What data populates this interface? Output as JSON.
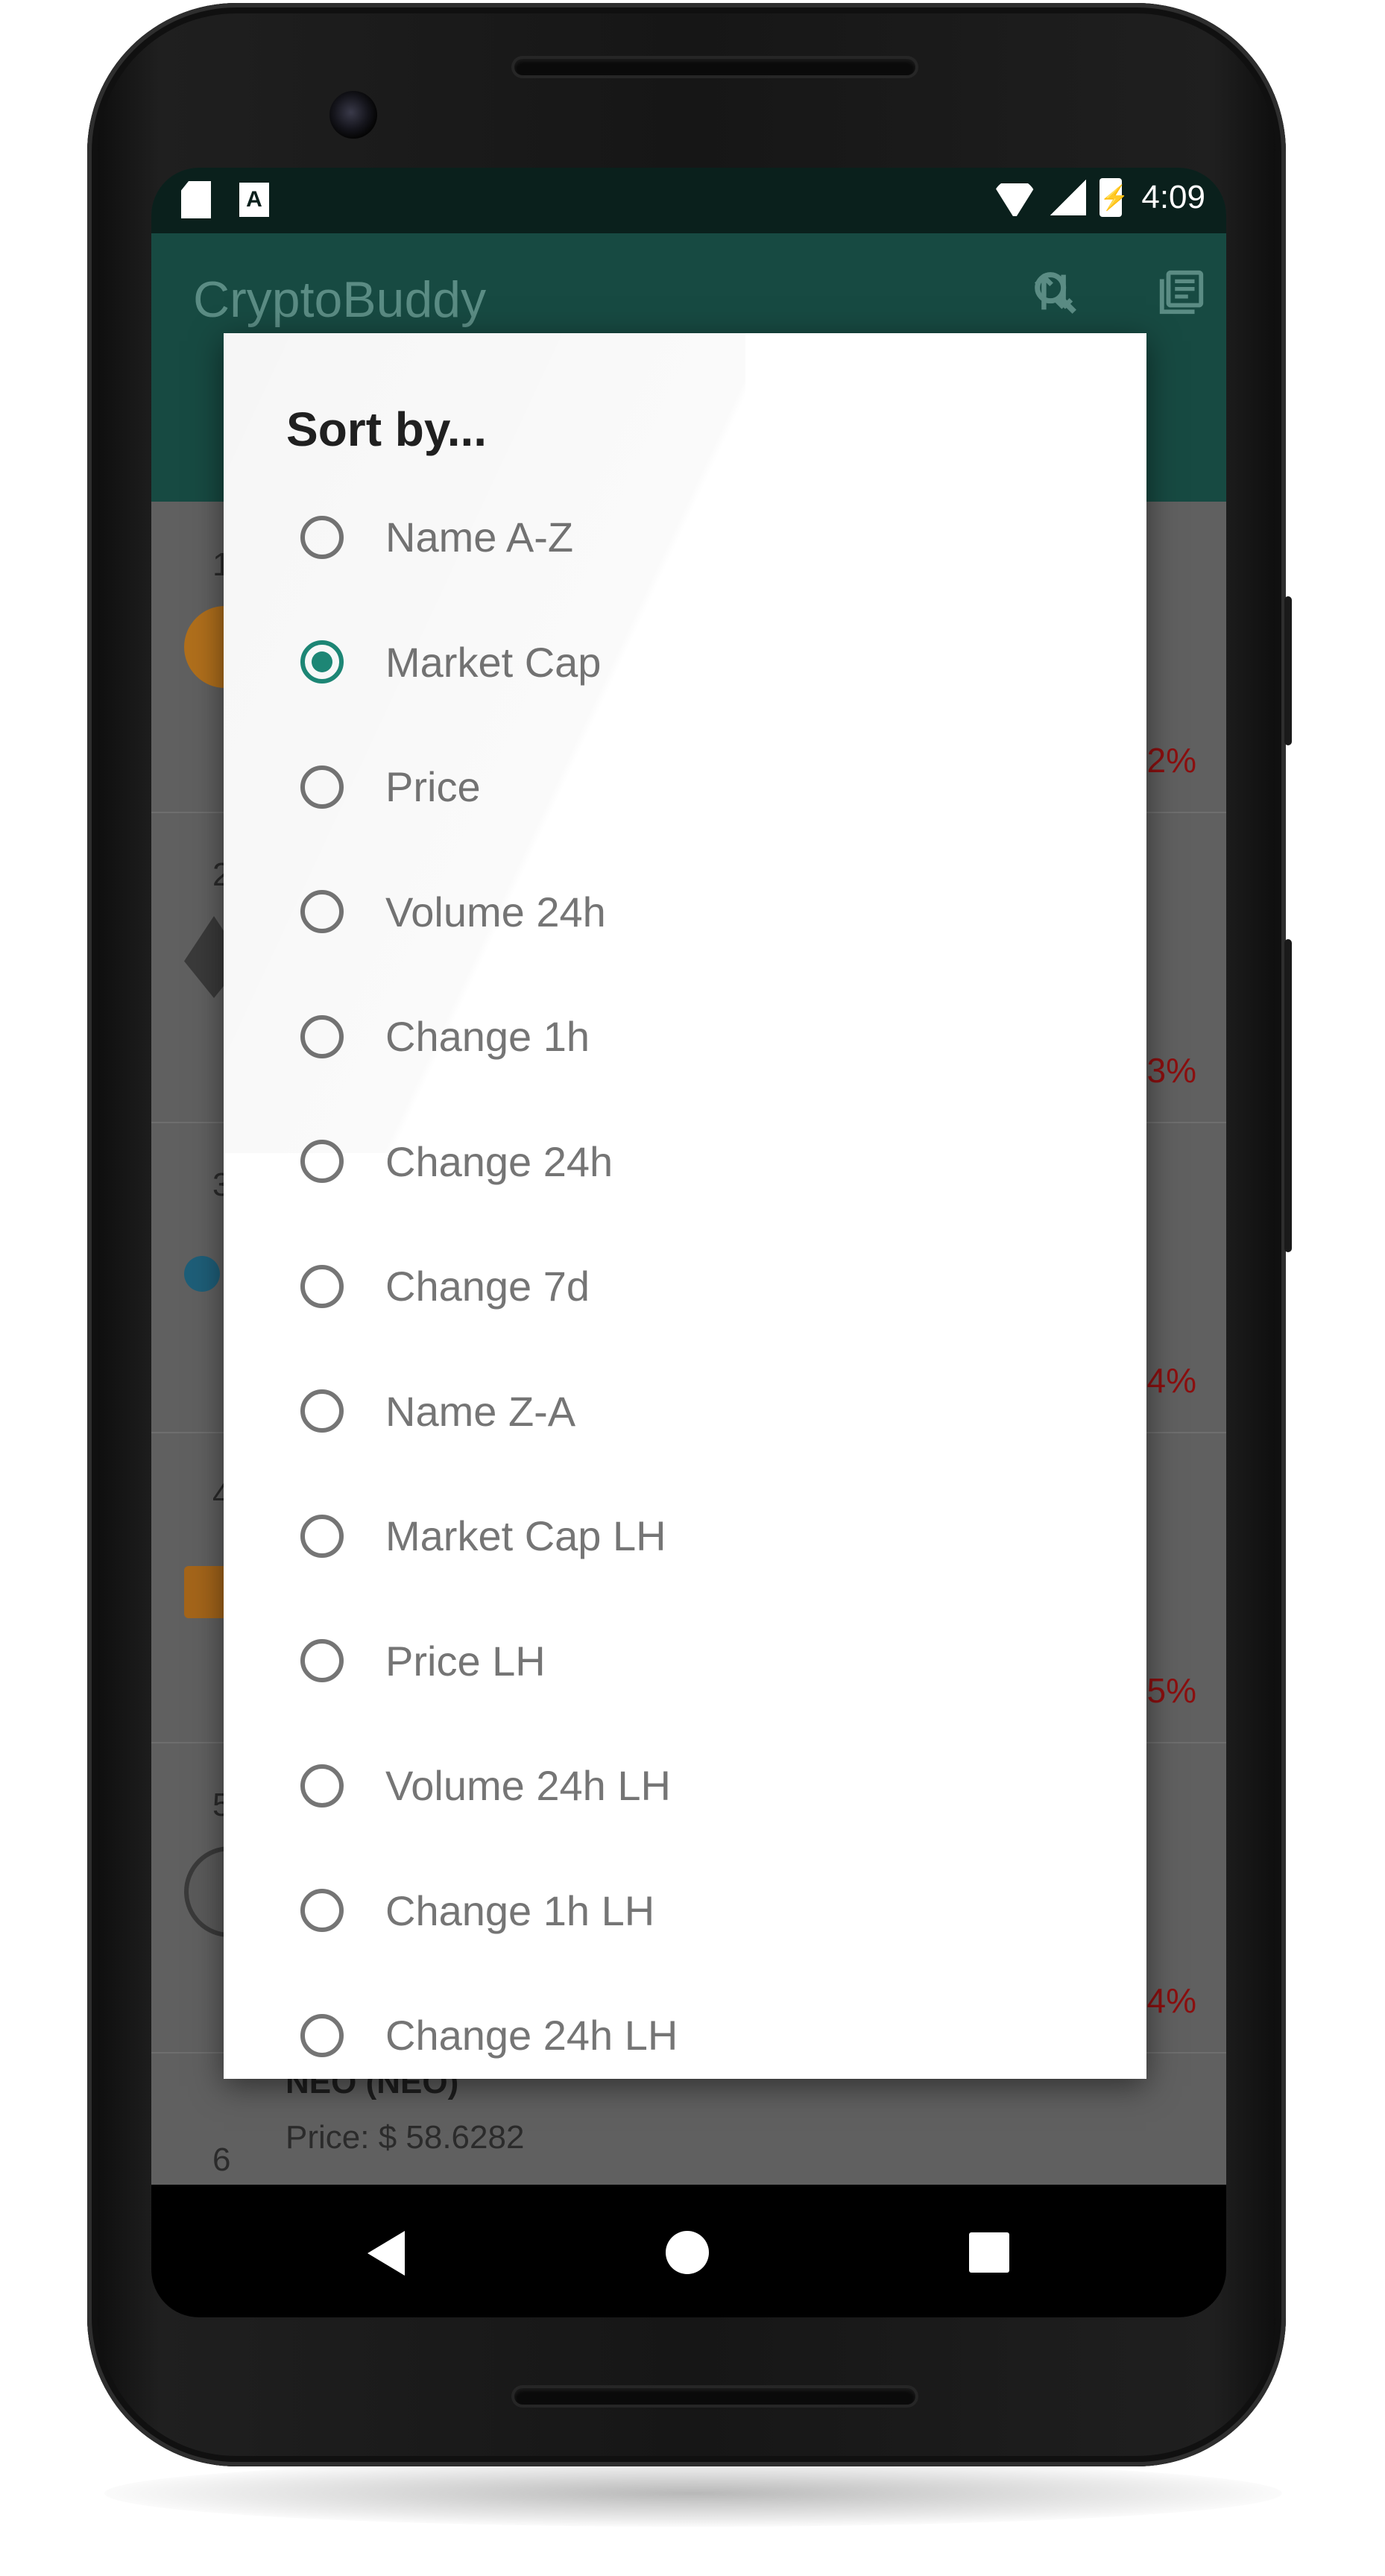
{
  "status_bar": {
    "sd_card_icon": "sd-card-icon",
    "keyboard_icon_label": "A",
    "time": "4:09"
  },
  "app_bar": {
    "title": "CryptoBuddy",
    "icons": [
      "search-icon",
      "sort-icon",
      "news-icon"
    ]
  },
  "list": {
    "row_numbers": [
      "1",
      "2",
      "3",
      "4",
      "5",
      "6"
    ],
    "change_tails": [
      "2%",
      "3%",
      "4%",
      "5%",
      "4%"
    ],
    "row6_name": "NEO (NEO)",
    "row6_price": "Price: $ 58.6282"
  },
  "dialog": {
    "title": "Sort by...",
    "selected_index": 1,
    "options": [
      "Name A-Z",
      "Market Cap",
      "Price",
      "Volume 24h",
      "Change 1h",
      "Change 24h",
      "Change 7d",
      "Name Z-A",
      "Market Cap LH",
      "Price LH",
      "Volume 24h LH",
      "Change 1h LH",
      "Change 24h LH"
    ]
  },
  "colors": {
    "app_bar": "#174a42",
    "accent": "#1e8a78",
    "negative_change": "#8b0f0f"
  }
}
